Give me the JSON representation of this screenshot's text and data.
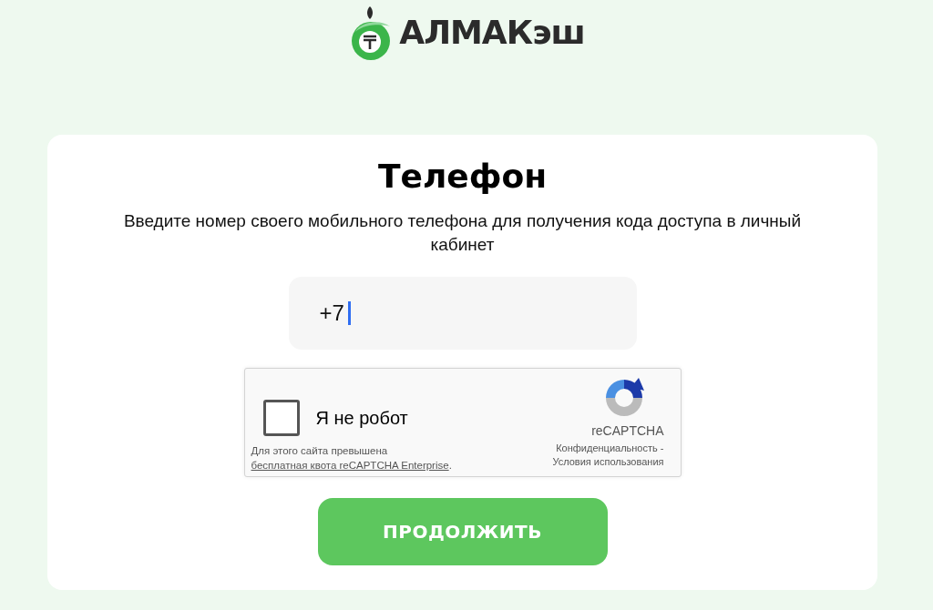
{
  "logo": {
    "text": "АЛМАКэш"
  },
  "card": {
    "title": "Телефон",
    "subtitle": "Введите номер своего мобильного телефона для получения кода доступа в личный кабинет",
    "phone_field": {
      "value": "+7",
      "focused": true
    },
    "recaptcha": {
      "checked": false,
      "label": "Я не робот",
      "brand": "reCAPTCHA",
      "quota_notice": {
        "text": "Для этого сайта превышена",
        "link": "бесплатная квота reCAPTCHA Enterprise",
        "suffix": "."
      },
      "privacy_link": "Конфиденциальность",
      "separator": "-",
      "terms_link": "Условия использования"
    },
    "submit_button": "ПРОДОЛЖИТЬ"
  }
}
